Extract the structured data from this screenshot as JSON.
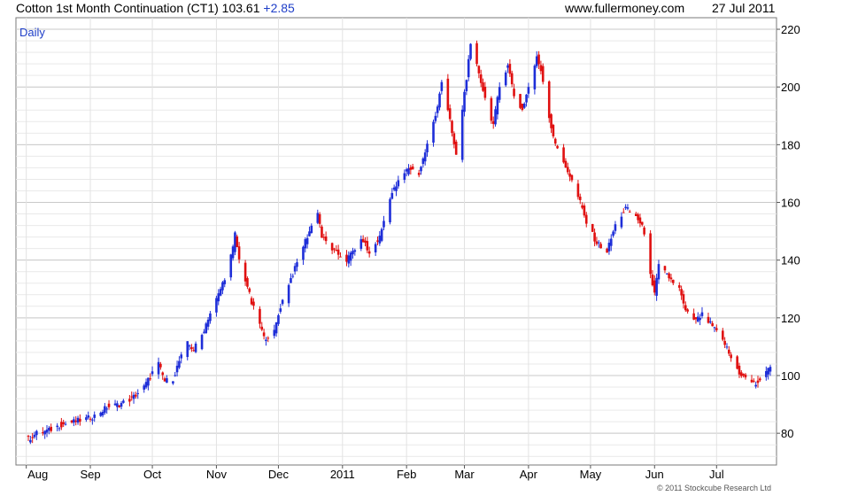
{
  "header": {
    "title": "Cotton 1st Month Continuation (CT1) 103.61",
    "change": "+2.85",
    "site": "www.fullermoney.com",
    "date": "27 Jul 2011"
  },
  "copyright": "© 2011 Stockcube Research Ltd",
  "chart_data": {
    "type": "candlestick",
    "period_label": "Daily",
    "ylim": [
      69,
      224
    ],
    "y_ticks": [
      80,
      100,
      120,
      140,
      160,
      180,
      200,
      220
    ],
    "x_ticks": [
      "Aug",
      "Sep",
      "Oct",
      "Nov",
      "Dec",
      "2011",
      "Feb",
      "Mar",
      "Apr",
      "May",
      "Jun",
      "Jul"
    ],
    "grid": true,
    "up_color": "#1e2ed8",
    "down_color": "#e01010",
    "series": [
      {
        "d": "2010-08-02",
        "c": 78
      },
      {
        "d": "2010-08-06",
        "c": 80
      },
      {
        "d": "2010-08-12",
        "c": 81
      },
      {
        "d": "2010-08-18",
        "c": 83
      },
      {
        "d": "2010-08-24",
        "c": 84
      },
      {
        "d": "2010-08-30",
        "c": 85
      },
      {
        "d": "2010-09-03",
        "c": 86
      },
      {
        "d": "2010-09-09",
        "c": 89
      },
      {
        "d": "2010-09-15",
        "c": 90
      },
      {
        "d": "2010-09-21",
        "c": 92
      },
      {
        "d": "2010-09-27",
        "c": 96
      },
      {
        "d": "2010-10-01",
        "c": 101
      },
      {
        "d": "2010-10-04",
        "c": 104
      },
      {
        "d": "2010-10-07",
        "c": 98
      },
      {
        "d": "2010-10-11",
        "c": 99
      },
      {
        "d": "2010-10-14",
        "c": 105
      },
      {
        "d": "2010-10-18",
        "c": 111
      },
      {
        "d": "2010-10-21",
        "c": 109
      },
      {
        "d": "2010-10-25",
        "c": 114
      },
      {
        "d": "2010-10-28",
        "c": 120
      },
      {
        "d": "2010-11-02",
        "c": 128
      },
      {
        "d": "2010-11-05",
        "c": 134
      },
      {
        "d": "2010-11-09",
        "c": 144
      },
      {
        "d": "2010-11-10",
        "c": 149
      },
      {
        "d": "2010-11-12",
        "c": 140
      },
      {
        "d": "2010-11-16",
        "c": 131
      },
      {
        "d": "2010-11-18",
        "c": 125
      },
      {
        "d": "2010-11-22",
        "c": 118
      },
      {
        "d": "2010-11-24",
        "c": 113
      },
      {
        "d": "2010-11-29",
        "c": 115
      },
      {
        "d": "2010-12-02",
        "c": 124
      },
      {
        "d": "2010-12-06",
        "c": 132
      },
      {
        "d": "2010-12-09",
        "c": 137
      },
      {
        "d": "2010-12-13",
        "c": 145
      },
      {
        "d": "2010-12-16",
        "c": 150
      },
      {
        "d": "2010-12-20",
        "c": 157
      },
      {
        "d": "2010-12-22",
        "c": 148
      },
      {
        "d": "2010-12-28",
        "c": 143
      },
      {
        "d": "2011-01-03",
        "c": 140
      },
      {
        "d": "2011-01-07",
        "c": 144
      },
      {
        "d": "2011-01-11",
        "c": 147
      },
      {
        "d": "2011-01-14",
        "c": 142
      },
      {
        "d": "2011-01-19",
        "c": 148
      },
      {
        "d": "2011-01-24",
        "c": 162
      },
      {
        "d": "2011-01-28",
        "c": 167
      },
      {
        "d": "2011-02-02",
        "c": 172
      },
      {
        "d": "2011-02-07",
        "c": 170
      },
      {
        "d": "2011-02-11",
        "c": 180
      },
      {
        "d": "2011-02-15",
        "c": 190
      },
      {
        "d": "2011-02-18",
        "c": 202
      },
      {
        "d": "2011-02-22",
        "c": 188
      },
      {
        "d": "2011-02-25",
        "c": 176
      },
      {
        "d": "2011-03-01",
        "c": 198
      },
      {
        "d": "2011-03-04",
        "c": 214
      },
      {
        "d": "2011-03-08",
        "c": 205
      },
      {
        "d": "2011-03-11",
        "c": 196
      },
      {
        "d": "2011-03-15",
        "c": 187
      },
      {
        "d": "2011-03-18",
        "c": 200
      },
      {
        "d": "2011-03-22",
        "c": 208
      },
      {
        "d": "2011-03-25",
        "c": 197
      },
      {
        "d": "2011-03-29",
        "c": 192
      },
      {
        "d": "2011-04-01",
        "c": 200
      },
      {
        "d": "2011-04-05",
        "c": 210
      },
      {
        "d": "2011-04-07",
        "c": 206
      },
      {
        "d": "2011-04-12",
        "c": 186
      },
      {
        "d": "2011-04-15",
        "c": 178
      },
      {
        "d": "2011-04-20",
        "c": 171
      },
      {
        "d": "2011-04-26",
        "c": 160
      },
      {
        "d": "2011-04-29",
        "c": 153
      },
      {
        "d": "2011-05-04",
        "c": 146
      },
      {
        "d": "2011-05-09",
        "c": 143
      },
      {
        "d": "2011-05-13",
        "c": 152
      },
      {
        "d": "2011-05-18",
        "c": 158
      },
      {
        "d": "2011-05-23",
        "c": 155
      },
      {
        "d": "2011-05-26",
        "c": 152
      },
      {
        "d": "2011-06-01",
        "c": 128
      },
      {
        "d": "2011-06-03",
        "c": 138
      },
      {
        "d": "2011-06-08",
        "c": 134
      },
      {
        "d": "2011-06-13",
        "c": 130
      },
      {
        "d": "2011-06-16",
        "c": 122
      },
      {
        "d": "2011-06-21",
        "c": 119
      },
      {
        "d": "2011-06-24",
        "c": 121
      },
      {
        "d": "2011-06-29",
        "c": 117
      },
      {
        "d": "2011-07-05",
        "c": 111
      },
      {
        "d": "2011-07-08",
        "c": 106
      },
      {
        "d": "2011-07-12",
        "c": 101
      },
      {
        "d": "2011-07-15",
        "c": 99
      },
      {
        "d": "2011-07-20",
        "c": 97
      },
      {
        "d": "2011-07-25",
        "c": 100.76
      },
      {
        "d": "2011-07-27",
        "c": 103.61
      }
    ]
  }
}
